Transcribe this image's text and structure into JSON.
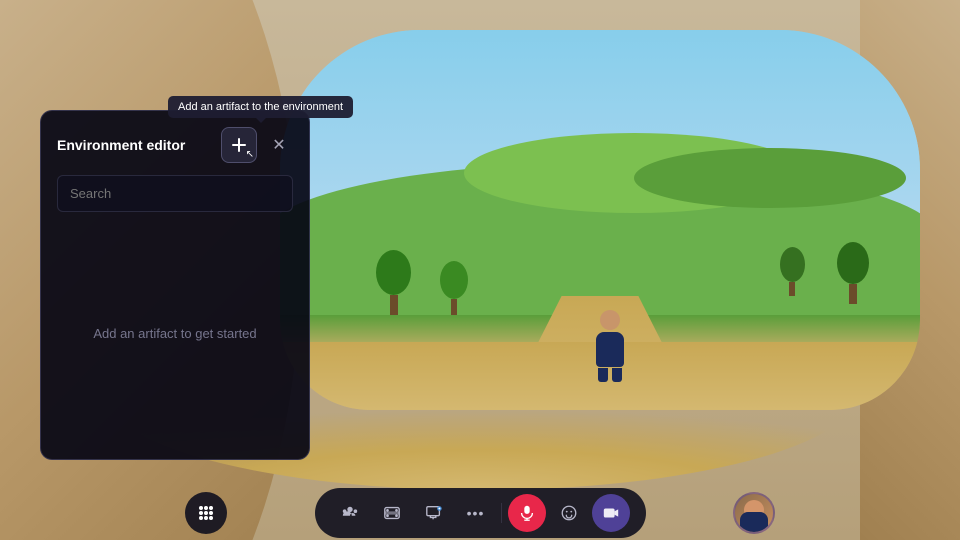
{
  "scene": {
    "background_color": "#c8b08a"
  },
  "tooltip": {
    "text": "Add an artifact to the environment"
  },
  "panel": {
    "title": "Environment editor",
    "search_placeholder": "Search",
    "empty_state": "Add an artifact to get started",
    "add_button_label": "+",
    "close_button_label": "✕"
  },
  "toolbar": {
    "buttons": [
      {
        "id": "people",
        "icon": "👥",
        "label": "People"
      },
      {
        "id": "media",
        "icon": "🎬",
        "label": "Media"
      },
      {
        "id": "share",
        "icon": "📋",
        "label": "Share"
      },
      {
        "id": "more",
        "icon": "•••",
        "label": "More"
      },
      {
        "id": "mic",
        "icon": "🎤",
        "label": "Mic"
      },
      {
        "id": "emoji",
        "icon": "🙂",
        "label": "Emoji"
      },
      {
        "id": "camera",
        "icon": "📷",
        "label": "Camera"
      }
    ],
    "left_button": "⋮⋮⋮",
    "avatar_chip": "avatar"
  }
}
